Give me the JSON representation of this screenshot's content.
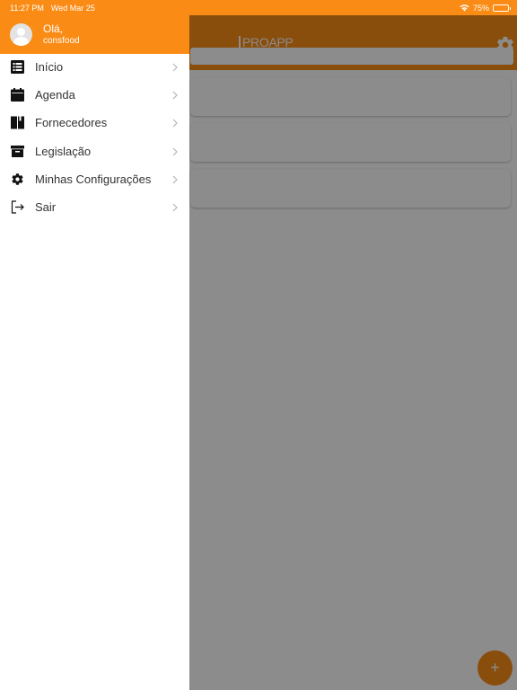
{
  "status_bar": {
    "time": "11:27 PM",
    "date": "Wed Mar 25",
    "battery": "75%",
    "battery_level": 0.75
  },
  "app": {
    "logo_text": "PROAPP",
    "fab_label": "+"
  },
  "drawer": {
    "greeting": "Olá,",
    "username": "consfood",
    "items": [
      {
        "label": "Início",
        "icon": "list-icon"
      },
      {
        "label": "Agenda",
        "icon": "calendar-icon"
      },
      {
        "label": "Fornecedores",
        "icon": "book-icon"
      },
      {
        "label": "Legislação",
        "icon": "archive-icon"
      },
      {
        "label": "Minhas Configurações",
        "icon": "gear-icon"
      },
      {
        "label": "Sair",
        "icon": "logout-icon"
      }
    ]
  },
  "colors": {
    "accent": "#fa8c16",
    "text": "#333333",
    "overlay": "rgba(0,0,0,0.45)"
  }
}
